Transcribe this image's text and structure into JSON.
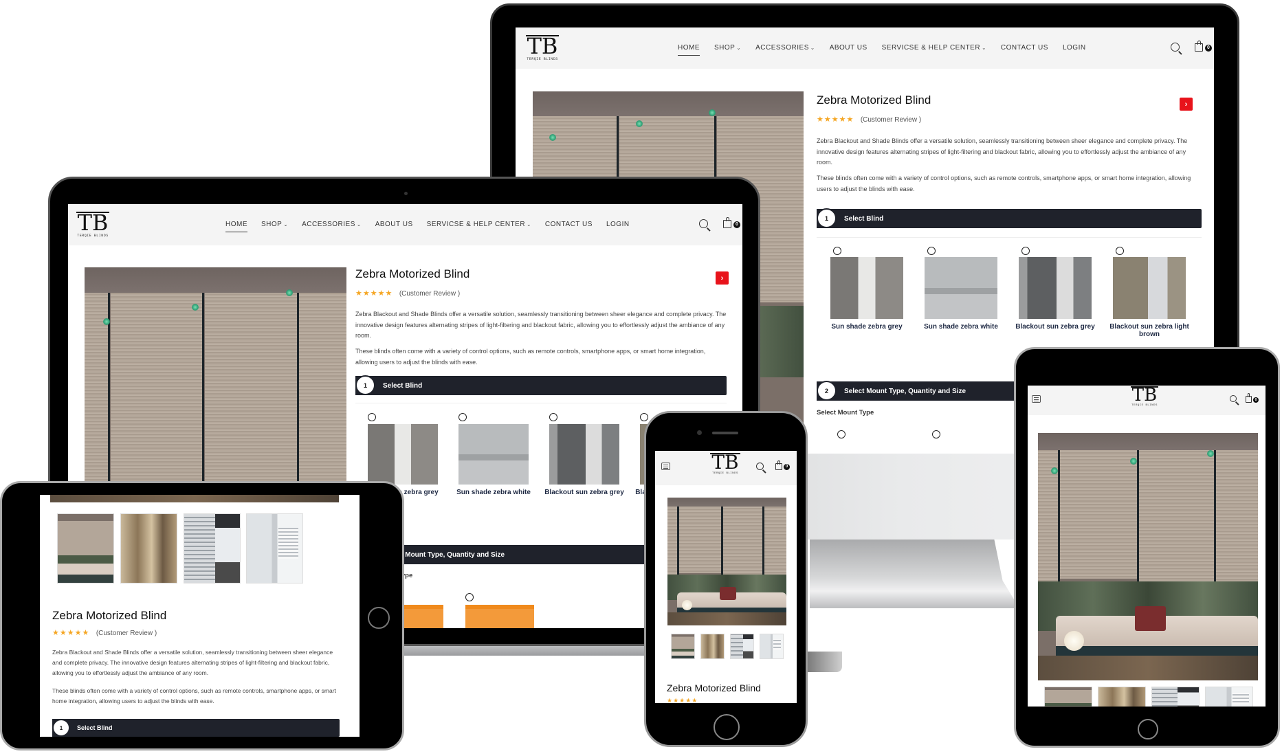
{
  "brand": {
    "logo_mark": "TB",
    "logo_name": "TERQIE BLINDS"
  },
  "nav": {
    "items": [
      {
        "label": "HOME",
        "active": true,
        "dropdown": false
      },
      {
        "label": "SHOP",
        "active": false,
        "dropdown": true
      },
      {
        "label": "ACCESSORIES",
        "active": false,
        "dropdown": true
      },
      {
        "label": "ABOUT US",
        "active": false,
        "dropdown": false
      },
      {
        "label": "SERVICSE & HELP CENTER",
        "active": false,
        "dropdown": true
      },
      {
        "label": "CONTACT US",
        "active": false,
        "dropdown": false
      },
      {
        "label": "LOGIN",
        "active": false,
        "dropdown": false
      }
    ],
    "caret": "⌄",
    "cart_count": "0",
    "icons": {
      "search": "search-icon",
      "cart": "shopping-bag-icon",
      "menu": "hamburger-menu-icon"
    }
  },
  "product": {
    "title": "Zebra Motorized Blind",
    "stars": "★★★★★",
    "rating": 5,
    "review_label": "(Customer Review )",
    "description_1": "Zebra Blackout and Shade Blinds offer a versatile solution, seamlessly transitioning between sheer elegance and complete privacy. The innovative design features alternating stripes of light-filtering and blackout fabric, allowing you to effortlessly adjust the ambiance of any room.",
    "description_2": " These blinds often come with a variety of control options, such as remote controls, smartphone apps, or smart home integration, allowing users to adjust the blinds with ease.",
    "next_button": "›"
  },
  "steps": [
    {
      "number": "1",
      "label": "Select Blind"
    },
    {
      "number": "2",
      "label": "Select Mount Type, Quantity and Size"
    }
  ],
  "blinds": [
    {
      "label": "Sun shade zebra grey",
      "selected": false
    },
    {
      "label": "Sun shade zebra white",
      "selected": false
    },
    {
      "label": "Blackout sun zebra grey",
      "selected": false
    },
    {
      "label": "Blackout sun zebra light brown",
      "selected": false
    }
  ],
  "mount": {
    "heading": "Select Mount Type"
  },
  "colors": {
    "accent_red": "#e8131b",
    "step_bar": "#1f222b",
    "star": "#f5a623",
    "mount_orange": "#f39a3a"
  }
}
